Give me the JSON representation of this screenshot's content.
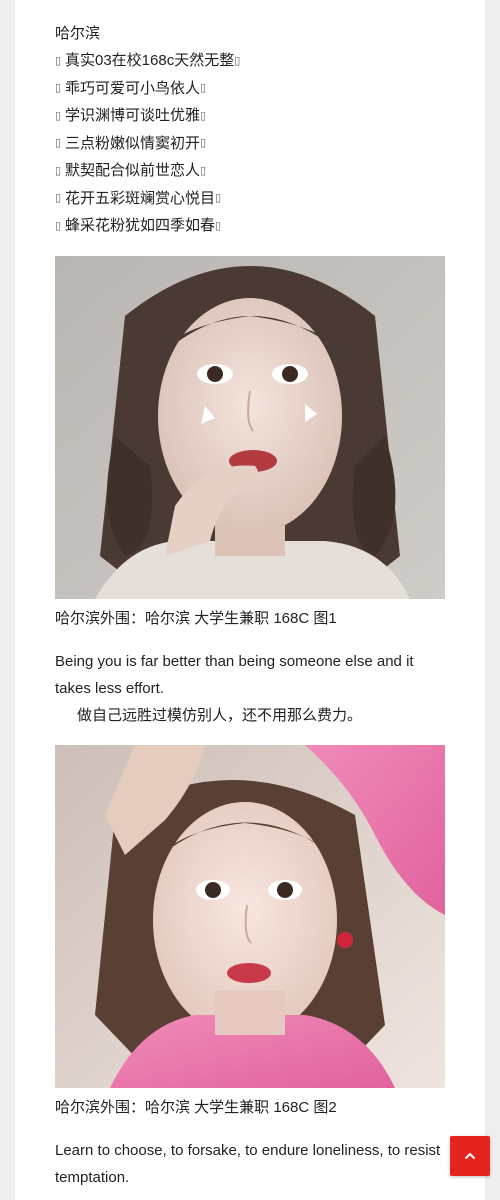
{
  "article": {
    "intro_title": "哈尔滨",
    "bullets": [
      "真实03在校168c天然无整",
      "乖巧可爱可小鸟依人",
      "学识渊博可谈吐优雅",
      "三点粉嫩似情窦初开",
      "默契配合似前世恋人",
      "花开五彩斑斓赏心悦目",
      "蜂采花粉犹如四季如春"
    ],
    "bullet_marker": "▯",
    "figures": [
      {
        "caption": "哈尔滨外围：哈尔滨 大学生兼职 168C 图1",
        "quote_en": "Being you is far better than being someone else and it takes less effort.",
        "quote_cn": "做自己远胜过模仿别人，还不用那么费力。"
      },
      {
        "caption": "哈尔滨外围：哈尔滨 大学生兼职 168C 图2",
        "quote_en": "Learn to choose, to forsake, to endure loneliness, to resist temptation."
      }
    ]
  },
  "ui": {
    "scroll_top_icon": "chevron-up-icon"
  },
  "colors": {
    "page_bg": "#eeeeee",
    "card_bg": "#ffffff",
    "text": "#222222",
    "accent_red": "#e52420",
    "shirt_pink": "#ef7fb0"
  }
}
